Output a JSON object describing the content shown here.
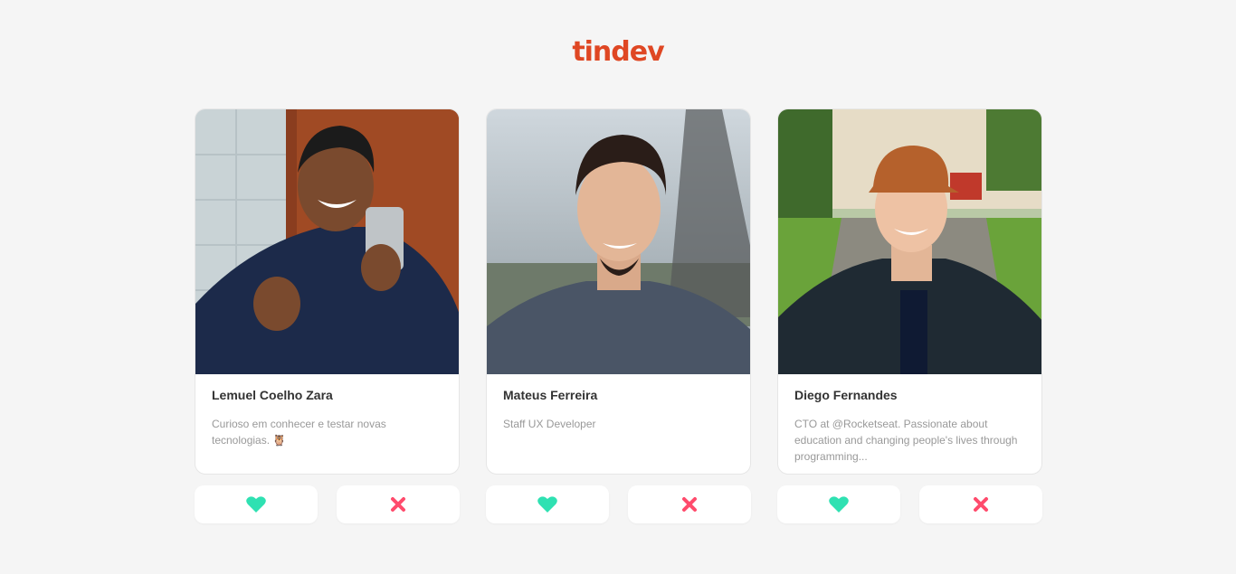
{
  "app": {
    "logo_text": "tindev",
    "brand_color": "#df4723"
  },
  "colors": {
    "like": "#2fe1b2",
    "dislike": "#ff4b6c"
  },
  "users": [
    {
      "name": "Lemuel Coelho Zara",
      "bio": "Curioso em conhecer e testar novas tecnologias. 🦉",
      "photo": "avatar-photo-lemuel",
      "like_icon": "heart-icon",
      "dislike_icon": "close-icon"
    },
    {
      "name": "Mateus Ferreira",
      "bio": "Staff UX Developer",
      "photo": "avatar-photo-mateus",
      "like_icon": "heart-icon",
      "dislike_icon": "close-icon"
    },
    {
      "name": "Diego Fernandes",
      "bio": "CTO at @Rocketseat. Passionate about education and changing people's lives through programming...",
      "photo": "avatar-photo-diego",
      "like_icon": "heart-icon",
      "dislike_icon": "close-icon"
    }
  ]
}
